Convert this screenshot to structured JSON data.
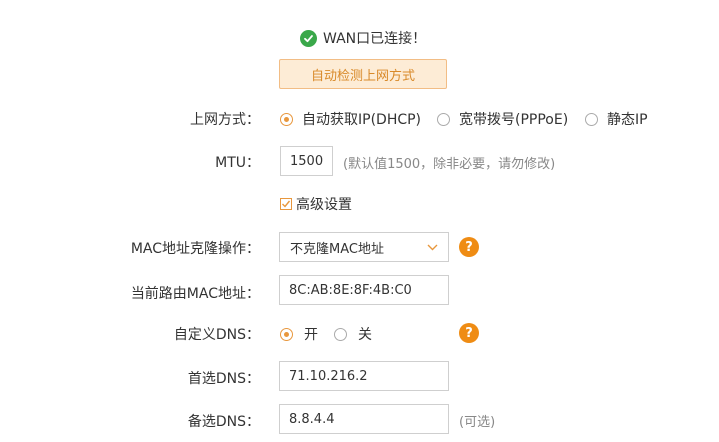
{
  "status": {
    "text": "WAN口已连接！",
    "icon": "check-circle-icon",
    "color": "#3aa84a"
  },
  "detect_button": {
    "label": "自动检测上网方式"
  },
  "connection_type": {
    "label": "上网方式：",
    "options": [
      {
        "label": "自动获取IP(DHCP)",
        "checked": true
      },
      {
        "label": "宽带拨号(PPPoE)",
        "checked": false
      },
      {
        "label": "静态IP",
        "checked": false
      }
    ]
  },
  "mtu": {
    "label": "MTU：",
    "value": "1500",
    "hint": "(默认值1500，除非必要，请勿修改)"
  },
  "advanced": {
    "label": "高级设置",
    "checked": true
  },
  "mac_clone": {
    "label": "MAC地址克隆操作：",
    "selected": "不克隆MAC地址",
    "help": "?"
  },
  "current_mac": {
    "label": "当前路由MAC地址：",
    "value": "8C:AB:8E:8F:4B:C0"
  },
  "custom_dns": {
    "label": "自定义DNS：",
    "options": [
      {
        "label": "开",
        "checked": true
      },
      {
        "label": "关",
        "checked": false
      }
    ],
    "help": "?"
  },
  "primary_dns": {
    "label": "首选DNS：",
    "value": "71.10.216.2"
  },
  "secondary_dns": {
    "label": "备选DNS：",
    "value": "8.8.4.4",
    "hint": "(可选)"
  },
  "colors": {
    "accent": "#e8973d",
    "help": "#ef8c14",
    "ok": "#3aa84a"
  }
}
